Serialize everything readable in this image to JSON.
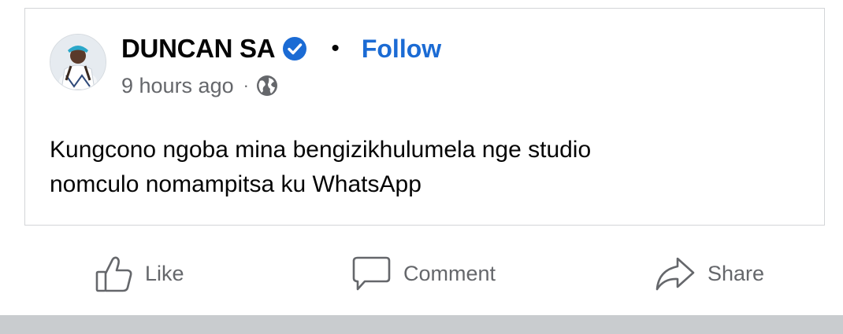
{
  "post": {
    "author": "DUNCAN SA",
    "follow_label": "Follow",
    "separator": "•",
    "time": "9 hours ago",
    "meta_separator": "·",
    "audience_icon": "globe-icon",
    "verified_icon": "verified-badge-icon",
    "text_line1": "Kungcono ngoba mina bengizikhulumela nge studio",
    "text_line2": "nomculo nomampitsa ku WhatsApp"
  },
  "actions": {
    "like_label": "Like",
    "comment_label": "Comment",
    "share_label": "Share"
  },
  "colors": {
    "accent": "#1b6bd4",
    "verified": "#1b6bd4",
    "muted_text": "#65676b",
    "bottom_bar": "#c9cccf"
  }
}
